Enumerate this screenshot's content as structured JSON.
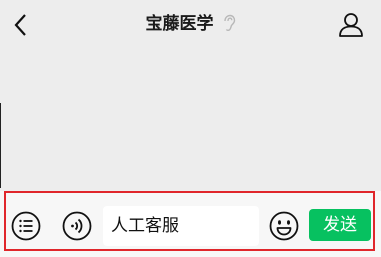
{
  "header": {
    "title": "宝藤医学",
    "back_icon": "chevron-left-icon",
    "listen_icon": "ear-icon",
    "profile_icon": "person-icon"
  },
  "input_bar": {
    "menu_icon": "list-menu-icon",
    "voice_icon": "voice-icon",
    "text_value": "人工客服",
    "emoji_icon": "smiley-icon",
    "send_label": "发送"
  },
  "colors": {
    "background": "#ededed",
    "input_bar_background": "#f7f7f7",
    "send_button": "#07c160",
    "highlight_border": "#e0262b"
  }
}
